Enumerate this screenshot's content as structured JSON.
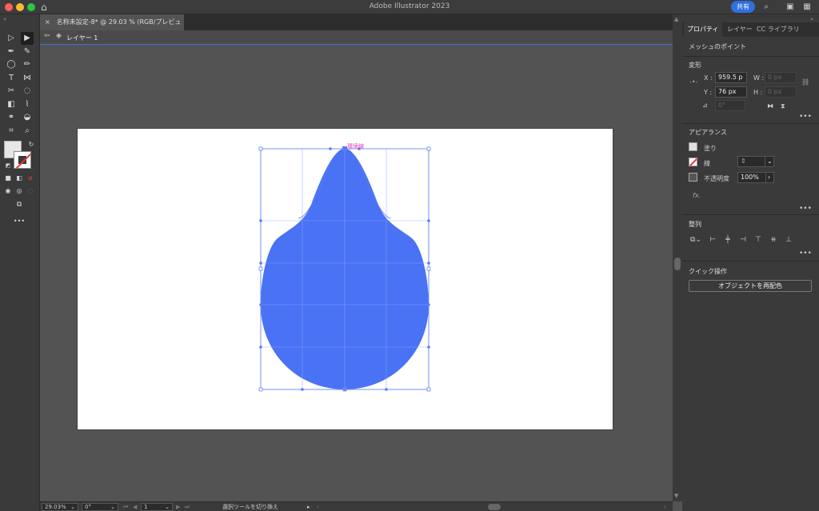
{
  "window": {
    "title": "Adobe Illustrator 2023",
    "share_label": "共有"
  },
  "document": {
    "tab_title": "名称未設定-8* @ 29.03 % (RGB/プレビュー)",
    "tab_close": "×",
    "layer_name": "レイヤー 1",
    "smart_guide_label": "環境線"
  },
  "shape": {
    "fill_color": "#4a72f5",
    "selection_color": "#5b7df0"
  },
  "status": {
    "zoom": "29.03%",
    "rotation": "0°",
    "artboard_num": "1",
    "tool_hint": "選択ツールを切り換え"
  },
  "tools": [
    {
      "name": "selection-tool",
      "glyph": "▷"
    },
    {
      "name": "direct-selection-tool",
      "glyph": "▶"
    },
    {
      "name": "pen-tool",
      "glyph": "✒"
    },
    {
      "name": "curvature-tool",
      "glyph": "✎"
    },
    {
      "name": "ellipse-tool",
      "glyph": "◯"
    },
    {
      "name": "pencil-tool",
      "glyph": "✏"
    },
    {
      "name": "type-tool",
      "glyph": "T"
    },
    {
      "name": "reflect-tool",
      "glyph": "⋈"
    },
    {
      "name": "scissors-tool",
      "glyph": "✂"
    },
    {
      "name": "lasso-tool",
      "glyph": "◌"
    },
    {
      "name": "gradient-tool",
      "glyph": "◧"
    },
    {
      "name": "eyedropper-tool",
      "glyph": "⌇"
    },
    {
      "name": "blend-tool",
      "glyph": "⚭"
    },
    {
      "name": "shape-builder-tool",
      "glyph": "◒"
    },
    {
      "name": "artboard-tool",
      "glyph": "⌗"
    },
    {
      "name": "zoom-tool",
      "glyph": "⌕"
    }
  ],
  "panel": {
    "tabs": [
      "プロパティ",
      "レイヤー",
      "CC ライブラリ"
    ],
    "selection_type": "メッシュのポイント",
    "transform": {
      "title": "変形",
      "x_label": "X :",
      "x_value": "959.5 p",
      "y_label": "Y :",
      "y_value": "76 px",
      "w_label": "W :",
      "w_value": "0 px",
      "h_label": "H :",
      "h_value": "0 px",
      "angle_value": "0°"
    },
    "appearance": {
      "title": "アピアランス",
      "fill_label": "塗り",
      "stroke_label": "線",
      "opacity_label": "不透明度",
      "opacity_value": "100%",
      "fx_label": "fx."
    },
    "align": {
      "title": "整列"
    },
    "quick_actions": {
      "title": "クイック操作",
      "recolor_label": "オブジェクトを再配色"
    },
    "more_label": "•••"
  }
}
